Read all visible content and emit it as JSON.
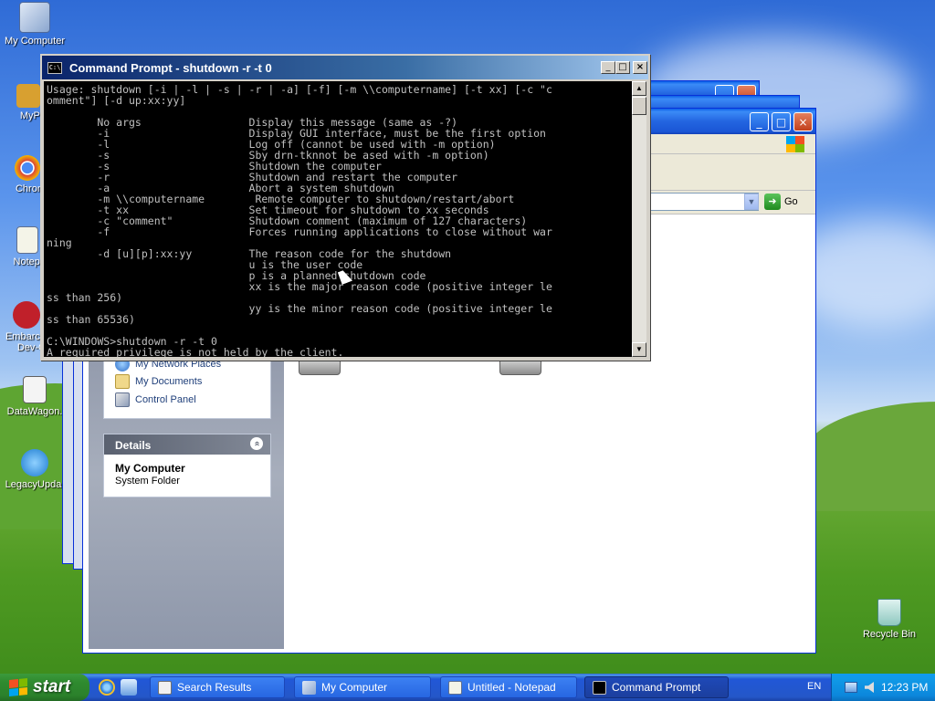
{
  "desktop": {
    "icons": [
      {
        "label": "My Computer"
      },
      {
        "label": "MyPa"
      },
      {
        "label": "Chrom"
      },
      {
        "label": "Notepa"
      },
      {
        "label": "Embarca Dev-C"
      },
      {
        "label": "DataWagon."
      },
      {
        "label": "LegacyUpda."
      },
      {
        "label": "Recycle Bin"
      }
    ]
  },
  "cmd": {
    "title": "Command Prompt - shutdown -r -t 0",
    "icon_text": "C:\\",
    "buttons": {
      "minimize": "_",
      "maximize": "□",
      "close": "×"
    },
    "scroll_up": "▲",
    "scroll_down": "▼",
    "console_text": "Usage: shutdown [-i | -l | -s | -r | -a] [-f] [-m \\\\computername] [-t xx] [-c \"c\nomment\"] [-d up:xx:yy]\n\n        No args                 Display this message (same as -?)\n        -i                      Display GUI interface, must be the first option\n        -l                      Log off (cannot be used with -m option)\n        -s                      Sby drn-tknnot be ased with -m option)\n        -s                      Shutdown the computer\n        -r                      Shutdown and restart the computer\n        -a                      Abort a system shutdown\n        -m \\\\computername        Remote computer to shutdown/restart/abort\n        -t xx                   Set timeout for shutdown to xx seconds\n        -c \"comment\"            Shutdown comment (maximum of 127 characters)\n        -f                      Forces running applications to close without war\nning\n        -d [u][p]:xx:yy         The reason code for the shutdown\n                                u is the user code\n                                p is a planned shutdown code\n                                xx is the major reason code (positive integer le\nss than 256)\n                                yy is the minor reason code (positive integer le\nss than 65536)\n\nC:\\WINDOWS>shutdown -r -t 0\nA required privilege is not held by the client."
  },
  "explorer": {
    "address_go": "Go",
    "other_places": [
      {
        "label": "My Network Places"
      },
      {
        "label": "My Documents"
      },
      {
        "label": "Control Panel"
      }
    ],
    "details": {
      "header": "Details",
      "collapse_glyph": "«",
      "name": "My Computer",
      "type": "System Folder"
    }
  },
  "taskbar": {
    "start_label": "start",
    "tasks": [
      {
        "label": "Search Results"
      },
      {
        "label": "My Computer"
      },
      {
        "label": "Untitled - Notepad"
      },
      {
        "label": "Command Prompt"
      }
    ],
    "language": "EN",
    "clock": "12:23 PM"
  },
  "colors": {
    "console_bg": "#000000",
    "console_fg": "#c0c0c0",
    "xp_title": "#2365e0",
    "taskbar": "#2457c8",
    "start_green": "#2f8b2f"
  },
  "icons": [
    "computer-icon",
    "shortcut-icon",
    "recycle-bin-icon",
    "cmd-icon",
    "windows-flag-icon",
    "ie-icon",
    "folder-icon",
    "notepad-icon",
    "network-places-icon",
    "documents-icon",
    "control-panel-icon",
    "drive-icon",
    "go-arrow-icon"
  ]
}
